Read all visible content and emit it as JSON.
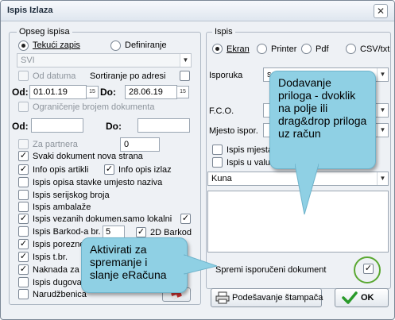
{
  "window": {
    "title": "Ispis Izlaza",
    "close_glyph": "✕"
  },
  "left": {
    "group_title": "Opseg ispisa",
    "scope": {
      "current": "Tekući zapis",
      "defined": "Definiranje"
    },
    "range_select": "SVI",
    "od_datuma": "Od datuma",
    "sortiranje": "Sortiranje po adresi",
    "od_label": "Od:",
    "do_label": "Do:",
    "date_from": "01.01.19",
    "date_to": "28.06.19",
    "calendar_glyph": "15",
    "limit_label": "Ograničenje brojem dokumenta",
    "od2_label": "Od:",
    "do2_label": "Do:",
    "partner_label": "Za partnera",
    "partner_value": "0",
    "options": [
      {
        "label": "Svaki dokument nova strana",
        "checked": true
      },
      {
        "label": "Info opis artikli",
        "checked": true
      },
      {
        "label": "Info opis izlaz",
        "checked": true
      },
      {
        "label": "Ispis opisa stavke umjesto naziva",
        "checked": false
      },
      {
        "label": "Ispis serijskog broja",
        "checked": false
      },
      {
        "label": "Ispis ambalaže",
        "checked": false
      },
      {
        "label": "Ispis vezanih dokumen.",
        "checked": true
      },
      {
        "label": "samo lokalni",
        "checked": true
      },
      {
        "label": "Ispis Barkod-a br.",
        "checked": false
      },
      {
        "label": "2D Barkod",
        "checked": true
      },
      {
        "label": "Ispis porezne",
        "checked": true
      },
      {
        "label": "Ispis t.br.",
        "checked": true
      },
      {
        "label": "Naknada za",
        "checked": true
      },
      {
        "label": "Ispis dugova",
        "checked": false
      },
      {
        "label": "Narudžbenica",
        "checked": false
      }
    ],
    "barcode_value": "5",
    "check_glyph": "✓"
  },
  "right": {
    "group_title": "Ispis",
    "outputs": [
      "Ekran",
      "Printer",
      "Pdf",
      "CSV/txt"
    ],
    "selected_output": "Ekran",
    "isporuka_label": "Isporuka",
    "isporuka_value": "s",
    "fco_label": "F.C.O.",
    "mjesto_label": "Mjesto ispor.",
    "ispis_mjesta_label": "Ispis mjesta",
    "ispis_valuti_label": "Ispis u valuti",
    "currency": "Kuna",
    "spremi_label": "Spremi isporučeni dokument"
  },
  "buttons": {
    "print_setup": "Podešavanje štampača",
    "ok": "OK"
  },
  "callouts": {
    "attachments": "Dodavanje priloga - dvoklik na polje ili drag&drop priloga uz račun",
    "erecun": "Aktivirati za spremanje i slanje eRačuna"
  },
  "colors": {
    "callout_bg": "#8fd0e4",
    "highlight_ring": "#5aa832",
    "ok_check": "#2a9a2a"
  }
}
